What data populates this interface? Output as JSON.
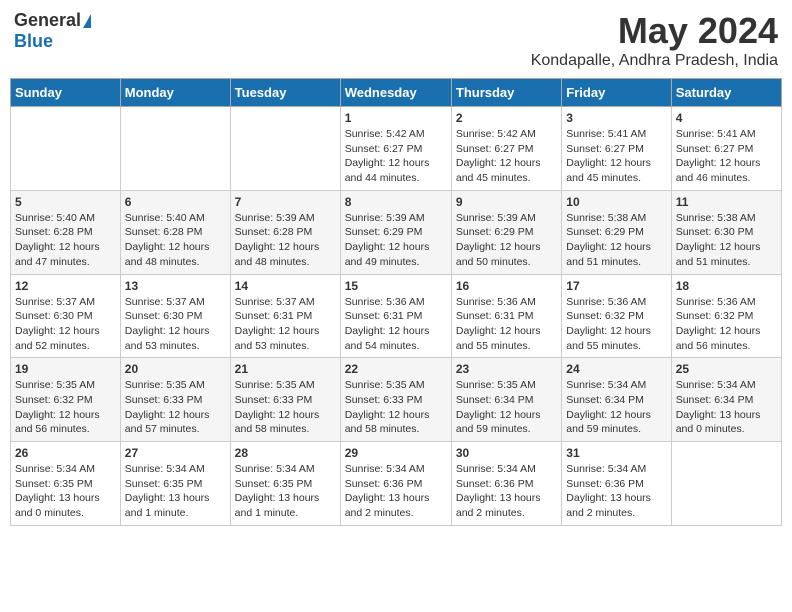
{
  "logo": {
    "general": "General",
    "blue": "Blue"
  },
  "title": "May 2024",
  "subtitle": "Kondapalle, Andhra Pradesh, India",
  "days": [
    "Sunday",
    "Monday",
    "Tuesday",
    "Wednesday",
    "Thursday",
    "Friday",
    "Saturday"
  ],
  "weeks": [
    [
      {
        "date": "",
        "info": ""
      },
      {
        "date": "",
        "info": ""
      },
      {
        "date": "",
        "info": ""
      },
      {
        "date": "1",
        "info": "Sunrise: 5:42 AM\nSunset: 6:27 PM\nDaylight: 12 hours\nand 44 minutes."
      },
      {
        "date": "2",
        "info": "Sunrise: 5:42 AM\nSunset: 6:27 PM\nDaylight: 12 hours\nand 45 minutes."
      },
      {
        "date": "3",
        "info": "Sunrise: 5:41 AM\nSunset: 6:27 PM\nDaylight: 12 hours\nand 45 minutes."
      },
      {
        "date": "4",
        "info": "Sunrise: 5:41 AM\nSunset: 6:27 PM\nDaylight: 12 hours\nand 46 minutes."
      }
    ],
    [
      {
        "date": "5",
        "info": "Sunrise: 5:40 AM\nSunset: 6:28 PM\nDaylight: 12 hours\nand 47 minutes."
      },
      {
        "date": "6",
        "info": "Sunrise: 5:40 AM\nSunset: 6:28 PM\nDaylight: 12 hours\nand 48 minutes."
      },
      {
        "date": "7",
        "info": "Sunrise: 5:39 AM\nSunset: 6:28 PM\nDaylight: 12 hours\nand 48 minutes."
      },
      {
        "date": "8",
        "info": "Sunrise: 5:39 AM\nSunset: 6:29 PM\nDaylight: 12 hours\nand 49 minutes."
      },
      {
        "date": "9",
        "info": "Sunrise: 5:39 AM\nSunset: 6:29 PM\nDaylight: 12 hours\nand 50 minutes."
      },
      {
        "date": "10",
        "info": "Sunrise: 5:38 AM\nSunset: 6:29 PM\nDaylight: 12 hours\nand 51 minutes."
      },
      {
        "date": "11",
        "info": "Sunrise: 5:38 AM\nSunset: 6:30 PM\nDaylight: 12 hours\nand 51 minutes."
      }
    ],
    [
      {
        "date": "12",
        "info": "Sunrise: 5:37 AM\nSunset: 6:30 PM\nDaylight: 12 hours\nand 52 minutes."
      },
      {
        "date": "13",
        "info": "Sunrise: 5:37 AM\nSunset: 6:30 PM\nDaylight: 12 hours\nand 53 minutes."
      },
      {
        "date": "14",
        "info": "Sunrise: 5:37 AM\nSunset: 6:31 PM\nDaylight: 12 hours\nand 53 minutes."
      },
      {
        "date": "15",
        "info": "Sunrise: 5:36 AM\nSunset: 6:31 PM\nDaylight: 12 hours\nand 54 minutes."
      },
      {
        "date": "16",
        "info": "Sunrise: 5:36 AM\nSunset: 6:31 PM\nDaylight: 12 hours\nand 55 minutes."
      },
      {
        "date": "17",
        "info": "Sunrise: 5:36 AM\nSunset: 6:32 PM\nDaylight: 12 hours\nand 55 minutes."
      },
      {
        "date": "18",
        "info": "Sunrise: 5:36 AM\nSunset: 6:32 PM\nDaylight: 12 hours\nand 56 minutes."
      }
    ],
    [
      {
        "date": "19",
        "info": "Sunrise: 5:35 AM\nSunset: 6:32 PM\nDaylight: 12 hours\nand 56 minutes."
      },
      {
        "date": "20",
        "info": "Sunrise: 5:35 AM\nSunset: 6:33 PM\nDaylight: 12 hours\nand 57 minutes."
      },
      {
        "date": "21",
        "info": "Sunrise: 5:35 AM\nSunset: 6:33 PM\nDaylight: 12 hours\nand 58 minutes."
      },
      {
        "date": "22",
        "info": "Sunrise: 5:35 AM\nSunset: 6:33 PM\nDaylight: 12 hours\nand 58 minutes."
      },
      {
        "date": "23",
        "info": "Sunrise: 5:35 AM\nSunset: 6:34 PM\nDaylight: 12 hours\nand 59 minutes."
      },
      {
        "date": "24",
        "info": "Sunrise: 5:34 AM\nSunset: 6:34 PM\nDaylight: 12 hours\nand 59 minutes."
      },
      {
        "date": "25",
        "info": "Sunrise: 5:34 AM\nSunset: 6:34 PM\nDaylight: 13 hours\nand 0 minutes."
      }
    ],
    [
      {
        "date": "26",
        "info": "Sunrise: 5:34 AM\nSunset: 6:35 PM\nDaylight: 13 hours\nand 0 minutes."
      },
      {
        "date": "27",
        "info": "Sunrise: 5:34 AM\nSunset: 6:35 PM\nDaylight: 13 hours\nand 1 minute."
      },
      {
        "date": "28",
        "info": "Sunrise: 5:34 AM\nSunset: 6:35 PM\nDaylight: 13 hours\nand 1 minute."
      },
      {
        "date": "29",
        "info": "Sunrise: 5:34 AM\nSunset: 6:36 PM\nDaylight: 13 hours\nand 2 minutes."
      },
      {
        "date": "30",
        "info": "Sunrise: 5:34 AM\nSunset: 6:36 PM\nDaylight: 13 hours\nand 2 minutes."
      },
      {
        "date": "31",
        "info": "Sunrise: 5:34 AM\nSunset: 6:36 PM\nDaylight: 13 hours\nand 2 minutes."
      },
      {
        "date": "",
        "info": ""
      }
    ]
  ]
}
